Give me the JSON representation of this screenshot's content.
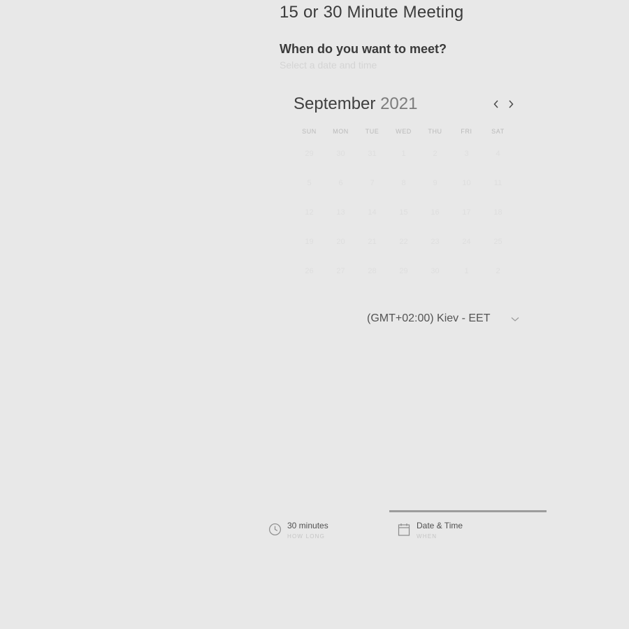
{
  "meeting": {
    "title": "15 or 30 Minute Meeting",
    "question": "When do you want to meet?",
    "subquestion": "Select a date and time"
  },
  "calendar": {
    "month": "September",
    "year": "2021",
    "prev_icon": "chevron-left-icon",
    "next_icon": "chevron-right-icon",
    "weekdays": [
      "SUN",
      "MON",
      "TUE",
      "WED",
      "THU",
      "FRI",
      "SAT"
    ],
    "days": [
      [
        "29",
        "30",
        "31",
        "1",
        "2",
        "3",
        "4"
      ],
      [
        "5",
        "6",
        "7",
        "8",
        "9",
        "10",
        "11"
      ],
      [
        "12",
        "13",
        "14",
        "15",
        "16",
        "17",
        "18"
      ],
      [
        "19",
        "20",
        "21",
        "22",
        "23",
        "24",
        "25"
      ],
      [
        "26",
        "27",
        "28",
        "29",
        "30",
        "1",
        "2"
      ]
    ]
  },
  "timezone": {
    "label": "(GMT+02:00) Kiev - EET",
    "icon": "chevron-down-icon"
  },
  "steps": [
    {
      "title": "30 minutes",
      "subtitle": "HOW LONG",
      "icon": "clock-icon"
    },
    {
      "title": "Date & Time",
      "subtitle": "WHEN",
      "icon": "calendar-icon"
    },
    {
      "title": "",
      "subtitle": ""
    }
  ],
  "colors": {
    "background": "#e8e8e8",
    "progress_line": "#9c9c9c",
    "text_primary": "#3b3b3b"
  }
}
